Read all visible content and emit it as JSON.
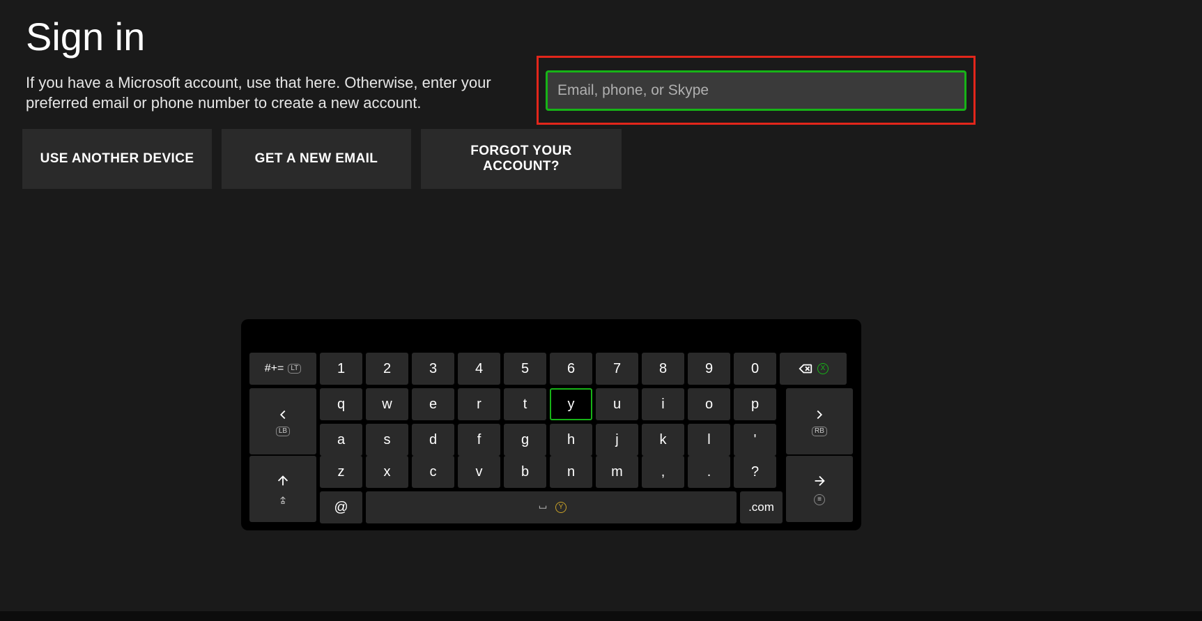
{
  "title": "Sign in",
  "subtitle": "If you have a Microsoft account, use that here. Otherwise, enter your preferred email or phone number to create a new account.",
  "input": {
    "placeholder": "Email, phone, or Skype",
    "value": ""
  },
  "buttons": [
    "USE ANOTHER DEVICE",
    "GET A NEW EMAIL",
    "FORGOT YOUR ACCOUNT?"
  ],
  "keyboard": {
    "sym_label": "#+=",
    "sym_badge": "LT",
    "numbers": [
      "1",
      "2",
      "3",
      "4",
      "5",
      "6",
      "7",
      "8",
      "9",
      "0"
    ],
    "row_q": [
      "q",
      "w",
      "e",
      "r",
      "t",
      "y",
      "u",
      "i",
      "o",
      "p"
    ],
    "row_a": [
      "a",
      "s",
      "d",
      "f",
      "g",
      "h",
      "j",
      "k",
      "l",
      "'"
    ],
    "row_z": [
      "z",
      "x",
      "c",
      "v",
      "b",
      "n",
      "m",
      ",",
      ".",
      "?"
    ],
    "selected_key": "y",
    "cursor_left_badge": "LB",
    "cursor_right_badge": "RB",
    "backspace_badge": "X",
    "at": "@",
    "space_badge": "Y",
    "com": ".com",
    "enter_badge": "≡"
  }
}
